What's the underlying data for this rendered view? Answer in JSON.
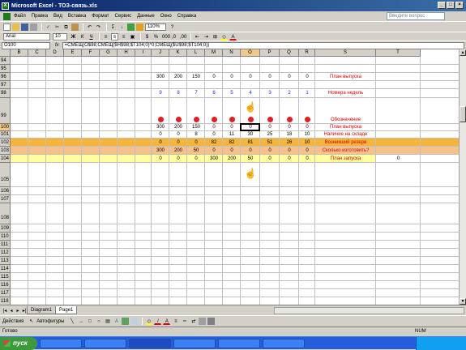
{
  "window": {
    "title": "Microsoft Excel - ТОЗ-связь.xls"
  },
  "menu": [
    "Файл",
    "Правка",
    "Вид",
    "Вставка",
    "Формат",
    "Сервис",
    "Данные",
    "Окно",
    "Справка"
  ],
  "ask_placeholder": "Введите вопрос",
  "toolbar": {
    "zoom": "110%",
    "font": "Arial",
    "size": "10"
  },
  "formula_bar": {
    "cell": "O100",
    "fx": "fx",
    "formula": "=СМЕЩ(O$98;СМЕЩ($H$98;$T104;0)*0;СМЕЩ($U$98;$T104;0))"
  },
  "columns": [
    "B",
    "C",
    "D",
    "E",
    "F",
    "G",
    "H",
    "I",
    "J",
    "K",
    "L",
    "M",
    "N",
    "O",
    "P",
    "Q",
    "R",
    "S",
    "T"
  ],
  "selected_column": "O",
  "rows": [
    "94",
    "95",
    "96",
    "97",
    "98",
    "99",
    "100",
    "101",
    "102",
    "103",
    "104",
    "105",
    "106",
    "107",
    "108",
    "109",
    "110",
    "111",
    "112",
    "113",
    "114",
    "115",
    "116",
    "117",
    "118",
    "119"
  ],
  "selected_row": "100",
  "data_rows": {
    "r96": [
      "300",
      "200",
      "150",
      "0",
      "0",
      "0",
      "0",
      "0",
      "0"
    ],
    "r98": [
      "9",
      "8",
      "7",
      "6",
      "5",
      "4",
      "3",
      "2",
      "1"
    ],
    "r100": [
      "300",
      "200",
      "150",
      "0",
      "0",
      "0",
      "0",
      "0",
      "0"
    ],
    "r101": [
      "0",
      "0",
      "8",
      "0",
      "11",
      "30",
      "25",
      "18",
      "10"
    ],
    "r102": [
      "0",
      "0",
      "0",
      "82",
      "82",
      "81",
      "51",
      "26",
      "10"
    ],
    "r103": [
      "300",
      "200",
      "50",
      "0",
      "0",
      "0",
      "0",
      "0",
      "0"
    ],
    "r104": [
      "0",
      "0",
      "0",
      "300",
      "200",
      "50",
      "0",
      "0",
      "0"
    ]
  },
  "row_labels": {
    "r96": "План выпуска",
    "r98": "Номера недель",
    "r99": "Обозначение",
    "r100": "План выпуска",
    "r101": "Наличие на складе",
    "r102": "Возникший резерв",
    "r103": "Сколько изготовить?",
    "r104": "План запуска"
  },
  "t104": "0",
  "sheets": [
    "Diagram1",
    "Page1"
  ],
  "active_sheet": "Page1",
  "draw_toolbar": {
    "actions": "Действия",
    "autoshapes": "Автофигуры"
  },
  "status": {
    "left": "Готово",
    "right": "NUM"
  },
  "taskbar": {
    "start": "пуск"
  },
  "colors": {
    "orange": "#f5b53a",
    "peach": "#f8c08a",
    "yellow": "#ffff9c",
    "red_label": "#e00000"
  }
}
